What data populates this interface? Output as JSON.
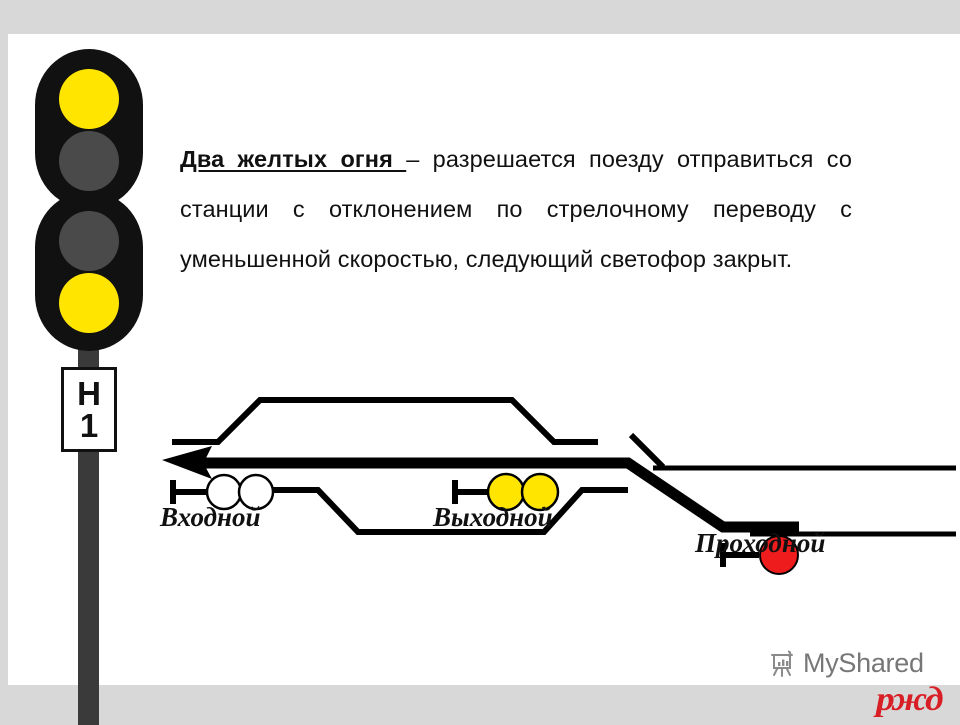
{
  "slide": {
    "background_color": "#d8d8d8",
    "page_color": "#ffffff"
  },
  "mast_signal": {
    "name": "two-head-dwarfless-mast-signal",
    "plate_line1": "Н",
    "plate_line2": "1",
    "pole_color": "#3a3a3a",
    "head_color": "#111111",
    "lamp_on_color": "#ffe500",
    "lamp_off_color": "#4a4a4a",
    "heads": [
      {
        "id": "upper",
        "lamps": [
          {
            "position": "top",
            "state": "yellow"
          },
          {
            "position": "bottom",
            "state": "off"
          }
        ]
      },
      {
        "id": "lower",
        "lamps": [
          {
            "position": "top",
            "state": "off"
          },
          {
            "position": "bottom",
            "state": "yellow"
          }
        ]
      }
    ]
  },
  "description": {
    "lead": "Два желтых огня ",
    "body": "– разрешается поезду отправиться со станции с отклонением по стрелочному переводу с уменьшенной скоростью, следующий светофор закрыт."
  },
  "diagram": {
    "title": "station-track-schematic",
    "labels": {
      "entry": "Входной",
      "exit": "Выходной",
      "block": "Проходной"
    },
    "signals": [
      {
        "name": "Входной",
        "lamps": 2,
        "lamp_color": "#ffffff",
        "state": "unlit"
      },
      {
        "name": "Выходной",
        "lamps": 2,
        "lamp_color": "#ffe500",
        "state": "two-yellow"
      },
      {
        "name": "Проходной",
        "lamps": 1,
        "lamp_color": "#ee1c1c",
        "state": "red"
      }
    ],
    "route_color": "#000000",
    "direction": "right-to-left-arrow"
  },
  "watermarks": {
    "myshared": "MyShared",
    "myshared_color": "#777777",
    "rzd": "ржд",
    "rzd_color": "#d81f26"
  }
}
